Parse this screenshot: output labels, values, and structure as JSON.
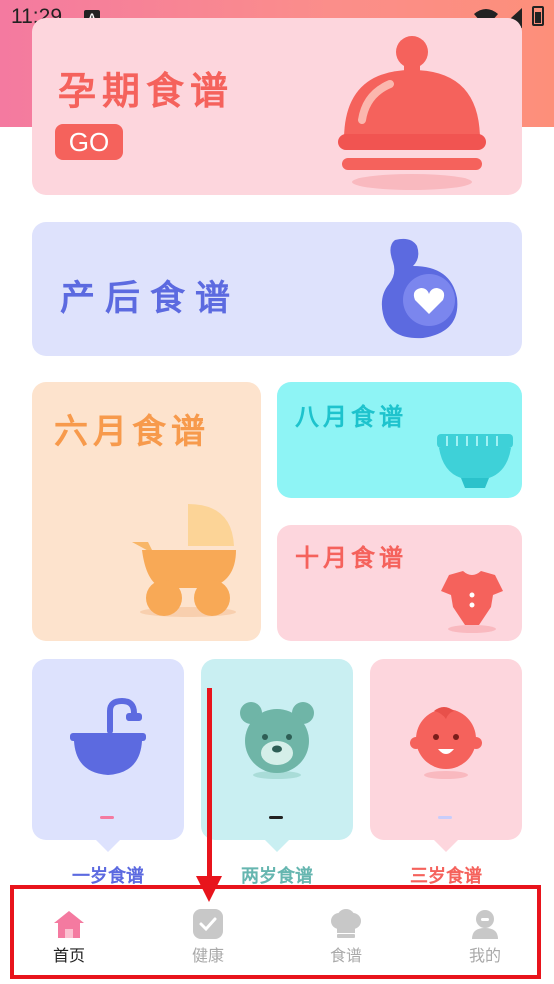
{
  "status_bar": {
    "time": "11:29",
    "notification_icon": "A"
  },
  "pregnancy_card": {
    "title": "孕期食谱",
    "go_label": "GO",
    "icon": "cloche-icon"
  },
  "postpartum_card": {
    "title": "产后食谱",
    "icon": "pregnant-belly-icon"
  },
  "six_month_card": {
    "title": "六月食谱",
    "icon": "stroller-icon"
  },
  "eight_month_card": {
    "title": "八月食谱",
    "icon": "diaper-icon"
  },
  "ten_month_card": {
    "title": "十月食谱",
    "icon": "onesie-icon"
  },
  "year_cards": [
    {
      "title": "一岁食谱",
      "icon": "bathtub-icon",
      "dash_color": "#f47aa0"
    },
    {
      "title": "两岁食谱",
      "icon": "bear-icon",
      "dash_color": "#222222"
    },
    {
      "title": "三岁食谱",
      "icon": "baby-face-icon",
      "dash_color": "#c8cdfb"
    }
  ],
  "bottom_nav": {
    "items": [
      {
        "label": "首页",
        "icon": "home-icon",
        "active": true
      },
      {
        "label": "健康",
        "icon": "check-icon",
        "active": false
      },
      {
        "label": "食谱",
        "icon": "chef-hat-icon",
        "active": false
      },
      {
        "label": "我的",
        "icon": "person-icon",
        "active": false
      }
    ]
  },
  "colors": {
    "accent_red": "#f5625c",
    "accent_blue": "#5c6ae0",
    "annotation_red": "#e8141c"
  }
}
